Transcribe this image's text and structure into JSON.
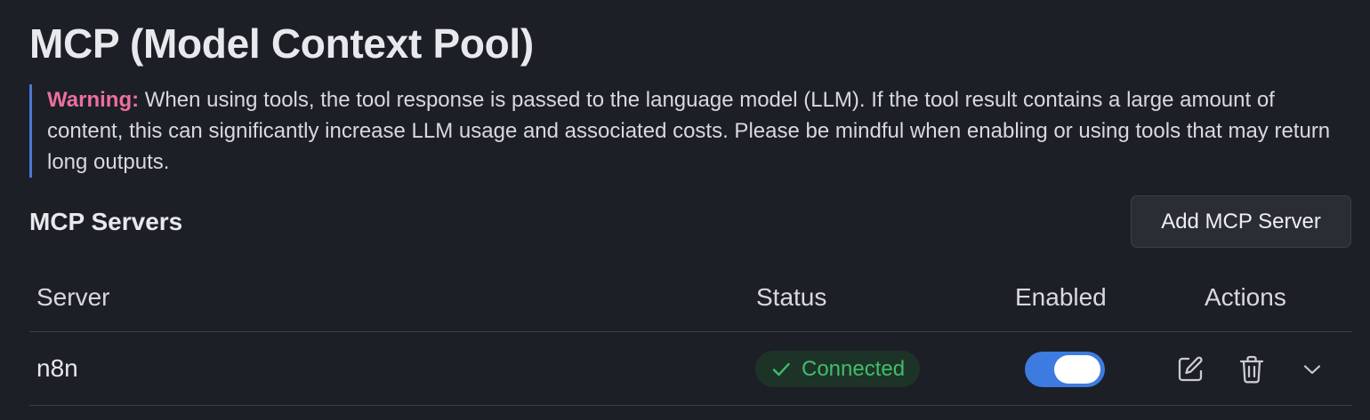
{
  "page": {
    "title": "MCP (Model Context Pool)"
  },
  "warning": {
    "label": "Warning:",
    "text": "When using tools, the tool response is passed to the language model (LLM). If the tool result contains a large amount of content, this can significantly increase LLM usage and associated costs. Please be mindful when enabling or using tools that may return long outputs.",
    "accent_color": "#4a78d1",
    "label_color": "#ec6f9c"
  },
  "servers_section": {
    "title": "MCP Servers",
    "add_button_label": "Add MCP Server"
  },
  "table": {
    "headers": {
      "server": "Server",
      "status": "Status",
      "enabled": "Enabled",
      "actions": "Actions"
    },
    "rows": [
      {
        "server": "n8n",
        "status": "Connected",
        "status_icon": "check-icon",
        "status_color": "#3fbe6a",
        "enabled": true,
        "actions": [
          "edit-icon",
          "trash-icon",
          "chevron-down-icon"
        ]
      }
    ]
  },
  "colors": {
    "background": "#1c1f26",
    "toggle_on": "#3d7be0"
  }
}
